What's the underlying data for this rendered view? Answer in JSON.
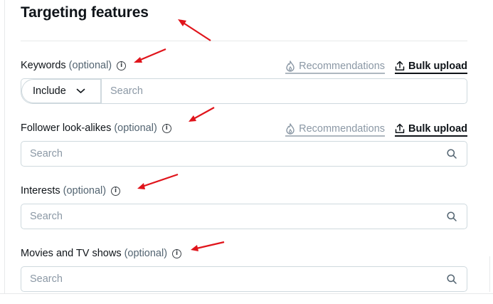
{
  "section": {
    "title": "Targeting features"
  },
  "fields": [
    {
      "label": "Keywords",
      "optional": "(optional)",
      "info_icon": "info-icon",
      "recommendations_label": "Recommendations",
      "bulk_upload_label": "Bulk upload",
      "select_value": "Include",
      "placeholder": "Search"
    },
    {
      "label": "Follower look-alikes",
      "optional": "(optional)",
      "info_icon": "info-icon",
      "recommendations_label": "Recommendations",
      "bulk_upload_label": "Bulk upload",
      "placeholder": "Search",
      "search_icon": "search-icon"
    },
    {
      "label": "Interests",
      "optional": "(optional)",
      "info_icon": "info-icon",
      "placeholder": "Search",
      "search_icon": "search-icon"
    },
    {
      "label": "Movies and TV shows",
      "optional": "(optional)",
      "info_icon": "info-icon",
      "placeholder": "Search",
      "search_icon": "search-icon"
    }
  ],
  "icons": {
    "recommendations": "flame-icon",
    "bulk_upload": "upload-icon",
    "select": "chevron-down-icon"
  },
  "colors": {
    "text": "#0f1419",
    "muted": "#536471",
    "placeholder": "#8b98a5",
    "border": "#cfd9de",
    "annotation_arrow": "#e0141b"
  }
}
